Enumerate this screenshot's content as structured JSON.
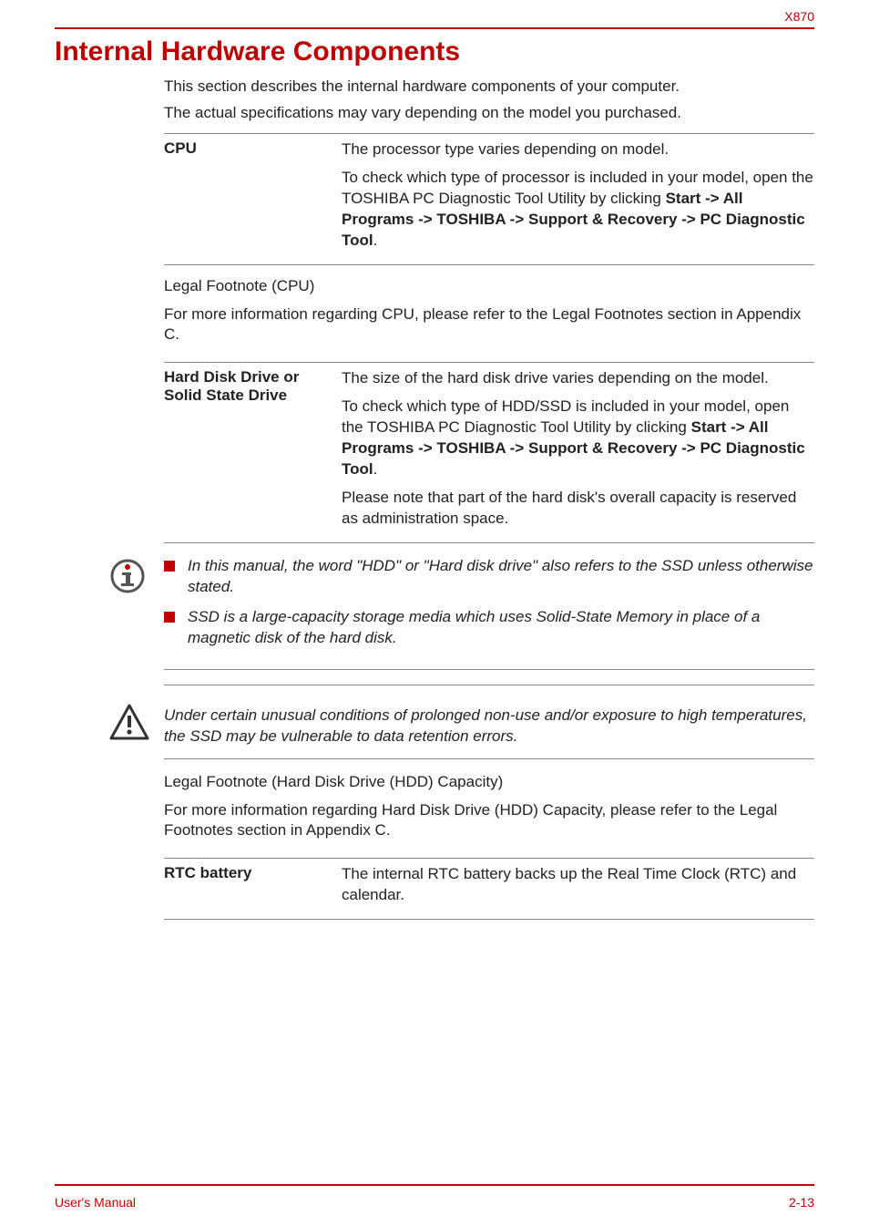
{
  "header": {
    "model": "X870"
  },
  "title": "Internal Hardware Components",
  "intro": {
    "p1": "This section describes the internal hardware components of your computer.",
    "p2": "The actual specifications may vary depending on the model you purchased."
  },
  "specs": {
    "cpu": {
      "label": "CPU",
      "p1": "The processor type varies depending on model.",
      "p2a": "To check which type of processor is included in your model, open the TOSHIBA PC Diagnostic Tool Utility by clicking ",
      "p2b": "Start -> All Programs -> TOSHIBA -> Support & Recovery -> PC Diagnostic Tool",
      "p2c": "."
    },
    "hdd": {
      "label": "Hard Disk Drive or Solid State Drive",
      "p1": "The size of the hard disk drive varies depending on the model.",
      "p2a": "To check which type of HDD/SSD is included in your model, open the TOSHIBA PC Diagnostic Tool Utility by clicking ",
      "p2b": "Start -> All Programs -> TOSHIBA -> Support & Recovery -> PC Diagnostic Tool",
      "p2c": ".",
      "p3": "Please note that part of the hard disk's overall capacity is reserved as administration space."
    },
    "rtc": {
      "label": "RTC battery",
      "p1": "The internal RTC battery backs up the Real Time Clock (RTC) and calendar."
    }
  },
  "legal_cpu": {
    "p1": "Legal Footnote (CPU)",
    "p2": "For more information regarding CPU, please refer to the Legal Footnotes section in Appendix C."
  },
  "info_note": {
    "b1": "In this manual, the word \"HDD\" or \"Hard disk drive\" also refers to the SSD unless otherwise stated.",
    "b2": "SSD is a large-capacity storage media which uses Solid-State Memory in place of a magnetic disk of the hard disk."
  },
  "caution_note": {
    "p1": "Under certain unusual conditions of prolonged non-use and/or exposure to high temperatures, the SSD may be vulnerable to data retention errors."
  },
  "legal_hdd": {
    "p1": "Legal Footnote (Hard Disk Drive (HDD) Capacity)",
    "p2": "For more information regarding Hard Disk Drive (HDD) Capacity, please refer to the Legal Footnotes section in Appendix C."
  },
  "footer": {
    "left": "User's Manual",
    "right": "2-13"
  },
  "icons": {
    "info": "info-icon",
    "caution": "caution-icon",
    "bullet": "red-square-bullet"
  }
}
